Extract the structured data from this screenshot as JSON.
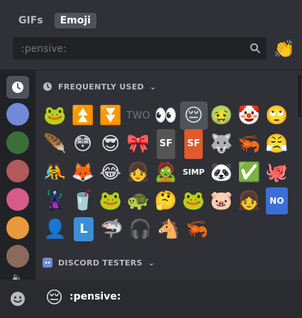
{
  "header": {
    "tabs": [
      {
        "label": "GIFs",
        "active": false
      },
      {
        "label": "Emoji",
        "active": true
      }
    ],
    "search": {
      "placeholder": ":pensive:",
      "value": ""
    },
    "random_emoji": "👏"
  },
  "sidebar": {
    "items": [
      "clock-icon",
      "server-icon-1",
      "server-icon-2",
      "server-icon-3",
      "server-icon-4",
      "server-icon-5",
      "server-icon-6",
      "server-icon-7"
    ]
  },
  "categories": [
    {
      "label": "FREQUENTLY USED",
      "icon": "clock-icon"
    },
    {
      "label": "DISCORD TESTERS",
      "icon": "discord-testers-icon"
    }
  ],
  "emoji_rows": [
    [
      "🐸",
      "⏫",
      "⏬",
      "TWO",
      "👀",
      "😔",
      "🤢",
      "🤡",
      "🙄"
    ],
    [
      "🪶",
      "😳",
      "😎",
      "🎀",
      "SF",
      "SF",
      "🐺",
      "🦐",
      "😤"
    ],
    [
      "🤼",
      "🦊",
      "😂",
      "👧",
      "🧟",
      "SIMP",
      "🐼",
      "✅",
      "🐙"
    ],
    [
      "🦹",
      "🥤",
      "🐸",
      "🐢",
      "🤔",
      "🐸",
      "🐷",
      "👧",
      "NO"
    ],
    [
      "👤",
      "L",
      "🦈",
      "🎧",
      "🐴",
      "🦐"
    ]
  ],
  "footer": {
    "preview_emoji": "😔",
    "preview_name": ":pensive:"
  },
  "colors": {
    "background": "#2f3136",
    "sidebar": "#202225",
    "footer": "#292b2f",
    "active_tab": "#4f545c"
  }
}
